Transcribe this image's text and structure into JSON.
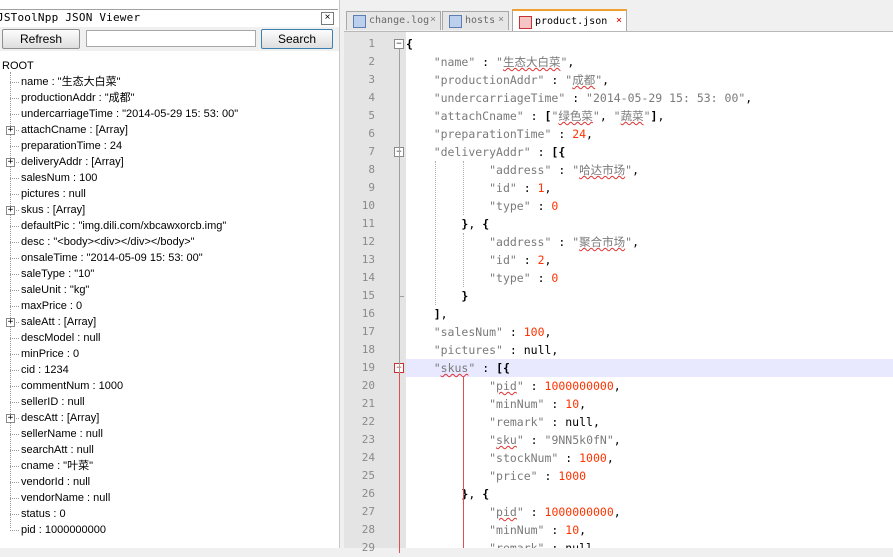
{
  "panel": {
    "title": "JSToolNpp JSON Viewer",
    "close_glyph": "×",
    "refresh_label": "Refresh",
    "search_label": "Search",
    "search_value": ""
  },
  "tree": {
    "root": "ROOT",
    "nodes": [
      {
        "text": "name : \"生态大白菜\"",
        "expandable": false
      },
      {
        "text": "productionAddr : \"成都\"",
        "expandable": false
      },
      {
        "text": "undercarriageTime : \"2014-05-29 15: 53: 00\"",
        "expandable": false
      },
      {
        "text": "attachCname : [Array]",
        "expandable": true
      },
      {
        "text": "preparationTime : 24",
        "expandable": false
      },
      {
        "text": "deliveryAddr : [Array]",
        "expandable": true
      },
      {
        "text": "salesNum : 100",
        "expandable": false
      },
      {
        "text": "pictures : null",
        "expandable": false
      },
      {
        "text": "skus : [Array]",
        "expandable": true
      },
      {
        "text": "defaultPic : \"img.dili.com/xbcawxorcb.img\"",
        "expandable": false
      },
      {
        "text": "desc : \"<body><div></div></body>\"",
        "expandable": false
      },
      {
        "text": "onsaleTime : \"2014-05-09 15: 53: 00\"",
        "expandable": false
      },
      {
        "text": "saleType : \"10\"",
        "expandable": false
      },
      {
        "text": "saleUnit : \"kg\"",
        "expandable": false
      },
      {
        "text": "maxPrice : 0",
        "expandable": false
      },
      {
        "text": "saleAtt : [Array]",
        "expandable": true
      },
      {
        "text": "descModel : null",
        "expandable": false
      },
      {
        "text": "minPrice : 0",
        "expandable": false
      },
      {
        "text": "cid : 1234",
        "expandable": false
      },
      {
        "text": "commentNum : 1000",
        "expandable": false
      },
      {
        "text": "sellerID : null",
        "expandable": false
      },
      {
        "text": "descAtt : [Array]",
        "expandable": true
      },
      {
        "text": "sellerName : null",
        "expandable": false
      },
      {
        "text": "searchAtt : null",
        "expandable": false
      },
      {
        "text": "cname : \"叶菜\"",
        "expandable": false
      },
      {
        "text": "vendorId : null",
        "expandable": false
      },
      {
        "text": "vendorName : null",
        "expandable": false
      },
      {
        "text": "status : 0",
        "expandable": false
      },
      {
        "text": "pid : 1000000000",
        "expandable": false
      }
    ]
  },
  "tabs": [
    {
      "label": "change.log",
      "active": false
    },
    {
      "label": "hosts",
      "active": false
    },
    {
      "label": "product.json",
      "active": true
    }
  ],
  "editor": {
    "current_line": 19,
    "lines": [
      {
        "n": "1",
        "text": "{"
      },
      {
        "n": "2",
        "text": "    \"name\" : \"生态大白菜\","
      },
      {
        "n": "3",
        "text": "    \"productionAddr\" : \"成都\","
      },
      {
        "n": "4",
        "text": "    \"undercarriageTime\" : \"2014-05-29 15: 53: 00\","
      },
      {
        "n": "5",
        "text": "    \"attachCname\" : [\"绿色菜\", \"蔬菜\"],"
      },
      {
        "n": "6",
        "text": "    \"preparationTime\" : 24,"
      },
      {
        "n": "7",
        "text": "    \"deliveryAddr\" : [{"
      },
      {
        "n": "8",
        "text": "            \"address\" : \"哈达市场\","
      },
      {
        "n": "9",
        "text": "            \"id\" : 1,"
      },
      {
        "n": "10",
        "text": "            \"type\" : 0"
      },
      {
        "n": "11",
        "text": "        }, {"
      },
      {
        "n": "12",
        "text": "            \"address\" : \"聚合市场\","
      },
      {
        "n": "13",
        "text": "            \"id\" : 2,"
      },
      {
        "n": "14",
        "text": "            \"type\" : 0"
      },
      {
        "n": "15",
        "text": "        }"
      },
      {
        "n": "16",
        "text": "    ],"
      },
      {
        "n": "17",
        "text": "    \"salesNum\" : 100,"
      },
      {
        "n": "18",
        "text": "    \"pictures\" : null,"
      },
      {
        "n": "19",
        "text": "    \"skus\" : [{"
      },
      {
        "n": "20",
        "text": "            \"pid\" : 1000000000,"
      },
      {
        "n": "21",
        "text": "            \"minNum\" : 10,"
      },
      {
        "n": "22",
        "text": "            \"remark\" : null,"
      },
      {
        "n": "23",
        "text": "            \"sku\" : \"9NN5k0fN\","
      },
      {
        "n": "24",
        "text": "            \"stockNum\" : 1000,"
      },
      {
        "n": "25",
        "text": "            \"price\" : 1000"
      },
      {
        "n": "26",
        "text": "        }, {"
      },
      {
        "n": "27",
        "text": "            \"pid\" : 1000000000,"
      },
      {
        "n": "28",
        "text": "            \"minNum\" : 10,"
      },
      {
        "n": "29",
        "text": "            \"remark\" : null,"
      }
    ]
  },
  "colors": {
    "string": "#7a7a7a",
    "number": "#ff3300",
    "current_line_bg": "#e8e8ff",
    "active_tab_accent": "#f0a030",
    "gutter_bg": "#e4e4e4"
  }
}
